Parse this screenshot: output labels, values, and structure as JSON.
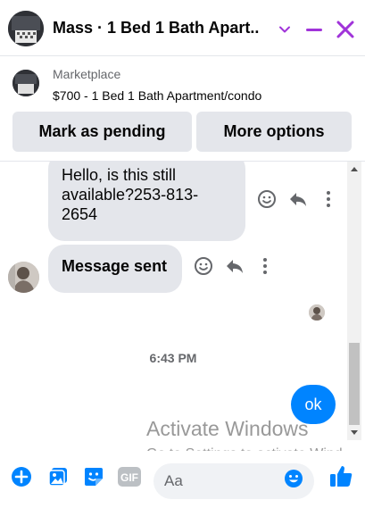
{
  "header": {
    "title": "Mass · 1 Bed 1 Bath Apart...",
    "chevron_icon": "chevron-down-icon",
    "minimize_icon": "minimize-icon",
    "close_icon": "close-icon",
    "accent_color": "#a033d9"
  },
  "listing": {
    "label": "Marketplace",
    "item": "$700 - 1 Bed 1 Bath Apartment/condo",
    "mark_pending_label": "Mark as pending",
    "more_options_label": "More options"
  },
  "messages": [
    {
      "direction": "incoming",
      "text": "Hello, is this still available?253-813-2654"
    },
    {
      "direction": "incoming",
      "text": "Message sent",
      "bold": true
    },
    {
      "direction": "outgoing",
      "text": "ok"
    }
  ],
  "timestamp": "6:43 PM",
  "watermark": {
    "line1": "Activate Windows",
    "line2": "Go to Settings to activate Wind"
  },
  "composer": {
    "placeholder": "Aa",
    "gif_label": "GIF"
  },
  "colors": {
    "brand_blue": "#0084ff",
    "bubble_gray": "#e4e6eb",
    "secondary_text": "#65676b"
  }
}
